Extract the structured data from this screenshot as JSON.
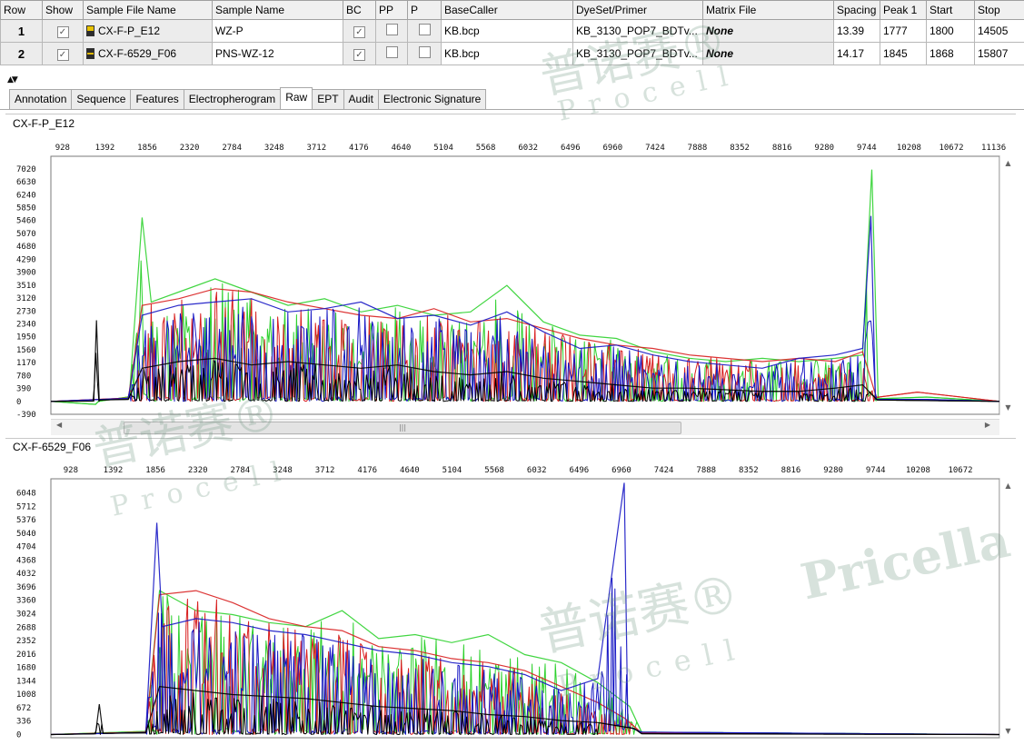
{
  "grid": {
    "headers": [
      "Row",
      "Show",
      "Sample File Name",
      "Sample Name",
      "BC",
      "PP",
      "P",
      "BaseCaller",
      "DyeSet/Primer",
      "Matrix File",
      "Spacing",
      "Peak 1",
      "Start",
      "Stop"
    ],
    "rows": [
      {
        "row": "1",
        "file": "CX-F-P_E12",
        "sample": "WZ-P",
        "basecaller": "KB.bcp",
        "dyeset": "KB_3130_POP7_BDTv...",
        "matrix": "None",
        "spacing": "13.39",
        "peak1": "1777",
        "start": "1800",
        "stop": "14505"
      },
      {
        "row": "2",
        "file": "CX-F-6529_F06",
        "sample": "PNS-WZ-12",
        "basecaller": "KB.bcp",
        "dyeset": "KB_3130_POP7_BDTv...",
        "matrix": "None",
        "spacing": "14.17",
        "peak1": "1845",
        "start": "1868",
        "stop": "15807"
      }
    ]
  },
  "tabs": [
    "Annotation",
    "Sequence",
    "Features",
    "Electropherogram",
    "Raw",
    "EPT",
    "Audit",
    "Electronic Signature"
  ],
  "active_tab": "Raw",
  "colors": {
    "green": "#2ed12e",
    "red": "#d81e1e",
    "blue": "#1515c4",
    "black": "#000000"
  },
  "watermarks": {
    "brand_cn": "普诺赛®",
    "brand_en": "Pricella",
    "sub": "Procell"
  },
  "chart_data": [
    {
      "type": "line",
      "title": "CX-F-P_E12",
      "x_ticks": [
        "928",
        "1392",
        "1856",
        "2320",
        "2784",
        "3248",
        "3712",
        "4176",
        "4640",
        "5104",
        "5568",
        "6032",
        "6496",
        "6960",
        "7424",
        "7888",
        "8352",
        "8816",
        "9280",
        "9744",
        "10208",
        "10672",
        "11136"
      ],
      "y_ticks": [
        "-390",
        "0",
        "390",
        "780",
        "1170",
        "1560",
        "1950",
        "2340",
        "2730",
        "3120",
        "3510",
        "3900",
        "4290",
        "4680",
        "5070",
        "5460",
        "5850",
        "6240",
        "6630",
        "7020"
      ],
      "xlim": [
        800,
        11200
      ],
      "ylim": [
        -390,
        7400
      ],
      "series": [
        {
          "color": "green",
          "values": [
            [
              800,
              0
            ],
            [
              1290,
              -90
            ],
            [
              1320,
              0
            ],
            [
              1660,
              140
            ],
            [
              1800,
              5550
            ],
            [
              1900,
              3000
            ],
            [
              2200,
              3300
            ],
            [
              2600,
              3700
            ],
            [
              3000,
              3300
            ],
            [
              3400,
              2900
            ],
            [
              3800,
              3100
            ],
            [
              4200,
              2700
            ],
            [
              4600,
              2900
            ],
            [
              5000,
              2600
            ],
            [
              5400,
              2700
            ],
            [
              5800,
              3500
            ],
            [
              6200,
              2400
            ],
            [
              6600,
              2000
            ],
            [
              7000,
              1900
            ],
            [
              7400,
              1500
            ],
            [
              7800,
              1300
            ],
            [
              8200,
              1200
            ],
            [
              8600,
              1300
            ],
            [
              9000,
              1200
            ],
            [
              9400,
              1300
            ],
            [
              9700,
              1400
            ],
            [
              9800,
              7000
            ],
            [
              9870,
              80
            ],
            [
              10400,
              130
            ],
            [
              11200,
              0
            ]
          ]
        },
        {
          "color": "red",
          "values": [
            [
              800,
              0
            ],
            [
              1650,
              100
            ],
            [
              1800,
              2900
            ],
            [
              2200,
              3100
            ],
            [
              2600,
              3400
            ],
            [
              3000,
              3300
            ],
            [
              3400,
              3000
            ],
            [
              3800,
              2800
            ],
            [
              4200,
              2600
            ],
            [
              4600,
              2500
            ],
            [
              5000,
              2800
            ],
            [
              5400,
              2400
            ],
            [
              5800,
              2500
            ],
            [
              6200,
              2200
            ],
            [
              6600,
              1900
            ],
            [
              7000,
              1700
            ],
            [
              7400,
              1600
            ],
            [
              7800,
              1400
            ],
            [
              8200,
              1300
            ],
            [
              8600,
              1200
            ],
            [
              9000,
              1300
            ],
            [
              9400,
              1200
            ],
            [
              9700,
              1500
            ],
            [
              9850,
              120
            ],
            [
              10300,
              280
            ],
            [
              11200,
              0
            ]
          ]
        },
        {
          "color": "blue",
          "values": [
            [
              800,
              0
            ],
            [
              1650,
              90
            ],
            [
              1800,
              2600
            ],
            [
              2200,
              2900
            ],
            [
              2600,
              3000
            ],
            [
              3000,
              3100
            ],
            [
              3400,
              2700
            ],
            [
              3800,
              2800
            ],
            [
              4200,
              3000
            ],
            [
              4600,
              2500
            ],
            [
              5000,
              2600
            ],
            [
              5400,
              2300
            ],
            [
              5800,
              2700
            ],
            [
              6200,
              2100
            ],
            [
              6600,
              1600
            ],
            [
              7000,
              1700
            ],
            [
              7400,
              1400
            ],
            [
              7800,
              1200
            ],
            [
              8200,
              1100
            ],
            [
              8600,
              1000
            ],
            [
              9000,
              1300
            ],
            [
              9400,
              1400
            ],
            [
              9700,
              1600
            ],
            [
              9790,
              5600
            ],
            [
              9840,
              60
            ],
            [
              10400,
              60
            ],
            [
              11200,
              0
            ]
          ]
        },
        {
          "color": "black",
          "values": [
            [
              800,
              0
            ],
            [
              1270,
              10
            ],
            [
              1300,
              2450
            ],
            [
              1330,
              40
            ],
            [
              1650,
              60
            ],
            [
              1800,
              1000
            ],
            [
              2200,
              1200
            ],
            [
              2600,
              1300
            ],
            [
              3000,
              1100
            ],
            [
              3400,
              1200
            ],
            [
              3800,
              1100
            ],
            [
              4200,
              1000
            ],
            [
              4600,
              1100
            ],
            [
              5000,
              900
            ],
            [
              5400,
              800
            ],
            [
              5800,
              900
            ],
            [
              6200,
              700
            ],
            [
              6600,
              600
            ],
            [
              7000,
              500
            ],
            [
              7400,
              400
            ],
            [
              7800,
              400
            ],
            [
              8200,
              350
            ],
            [
              8600,
              300
            ],
            [
              9000,
              300
            ],
            [
              9400,
              400
            ],
            [
              9700,
              500
            ],
            [
              9860,
              40
            ],
            [
              11200,
              0
            ]
          ]
        }
      ]
    },
    {
      "type": "line",
      "title": "CX-F-6529_F06",
      "x_ticks": [
        "928",
        "1392",
        "1856",
        "2320",
        "2784",
        "3248",
        "3712",
        "4176",
        "4640",
        "5104",
        "5568",
        "6032",
        "6496",
        "6960",
        "7424",
        "7888",
        "8352",
        "8816",
        "9280",
        "9744",
        "10208",
        "10672"
      ],
      "y_ticks": [
        "0",
        "336",
        "672",
        "1008",
        "1344",
        "1680",
        "2016",
        "2352",
        "2688",
        "3024",
        "3360",
        "3696",
        "4032",
        "4368",
        "4704",
        "5040",
        "5376",
        "5712",
        "6048"
      ],
      "xlim": [
        710,
        11100
      ],
      "ylim": [
        -80,
        6400
      ],
      "series": [
        {
          "color": "green",
          "values": [
            [
              710,
              0
            ],
            [
              1750,
              80
            ],
            [
              1900,
              3600
            ],
            [
              2300,
              3100
            ],
            [
              2700,
              3000
            ],
            [
              3100,
              2800
            ],
            [
              3500,
              2700
            ],
            [
              3900,
              3100
            ],
            [
              4300,
              2400
            ],
            [
              4700,
              2500
            ],
            [
              5100,
              2300
            ],
            [
              5500,
              2500
            ],
            [
              5900,
              2000
            ],
            [
              6300,
              1800
            ],
            [
              6700,
              1300
            ],
            [
              7050,
              700
            ],
            [
              7180,
              60
            ],
            [
              11100,
              0
            ]
          ]
        },
        {
          "color": "red",
          "values": [
            [
              710,
              0
            ],
            [
              1750,
              60
            ],
            [
              1900,
              3500
            ],
            [
              2300,
              3600
            ],
            [
              2700,
              3300
            ],
            [
              3100,
              2900
            ],
            [
              3500,
              2700
            ],
            [
              3900,
              2600
            ],
            [
              4300,
              2200
            ],
            [
              4700,
              2100
            ],
            [
              5100,
              1900
            ],
            [
              5500,
              1800
            ],
            [
              5900,
              1600
            ],
            [
              6300,
              1200
            ],
            [
              6700,
              800
            ],
            [
              7000,
              400
            ],
            [
              7180,
              40
            ],
            [
              11100,
              0
            ]
          ]
        },
        {
          "color": "blue",
          "values": [
            [
              710,
              0
            ],
            [
              1750,
              50
            ],
            [
              1870,
              5300
            ],
            [
              1930,
              2700
            ],
            [
              2300,
              2900
            ],
            [
              2700,
              2800
            ],
            [
              3100,
              2600
            ],
            [
              3500,
              2500
            ],
            [
              3900,
              2300
            ],
            [
              4300,
              2100
            ],
            [
              4700,
              2000
            ],
            [
              5100,
              1800
            ],
            [
              5500,
              1700
            ],
            [
              5900,
              1500
            ],
            [
              6300,
              1100
            ],
            [
              6700,
              1400
            ],
            [
              6990,
              6300
            ],
            [
              7030,
              200
            ],
            [
              7180,
              60
            ],
            [
              11100,
              0
            ]
          ]
        },
        {
          "color": "black",
          "values": [
            [
              710,
              0
            ],
            [
              1200,
              20
            ],
            [
              1240,
              760
            ],
            [
              1280,
              30
            ],
            [
              1750,
              40
            ],
            [
              1900,
              1200
            ],
            [
              2300,
              1100
            ],
            [
              2700,
              1000
            ],
            [
              3100,
              950
            ],
            [
              3500,
              900
            ],
            [
              3900,
              800
            ],
            [
              4300,
              700
            ],
            [
              4700,
              650
            ],
            [
              5100,
              600
            ],
            [
              5500,
              500
            ],
            [
              5900,
              450
            ],
            [
              6300,
              350
            ],
            [
              6700,
              300
            ],
            [
              7100,
              150
            ],
            [
              7180,
              20
            ],
            [
              11100,
              0
            ]
          ]
        }
      ]
    }
  ]
}
